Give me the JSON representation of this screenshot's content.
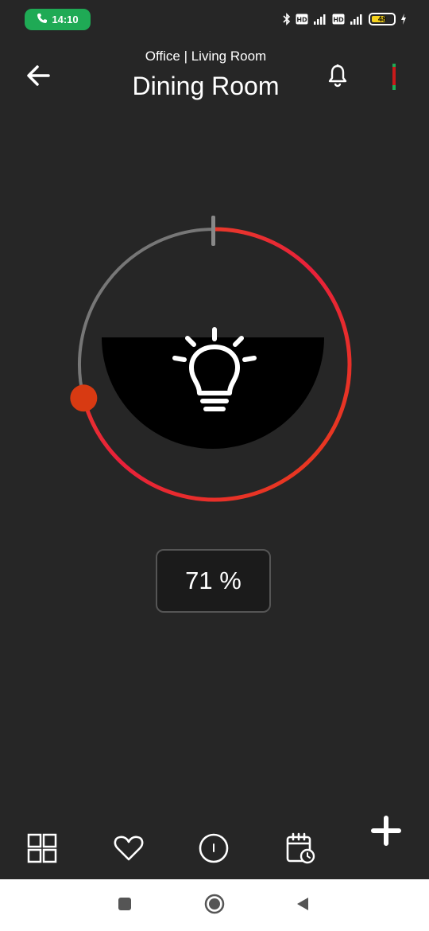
{
  "status_bar": {
    "call_time": "14:10",
    "call_icon": "phone-icon",
    "battery_level": "48",
    "icons": [
      "bluetooth-icon",
      "hd-icon",
      "signal-icon",
      "hd-icon",
      "signal-icon",
      "battery-icon",
      "charging-icon"
    ]
  },
  "header": {
    "breadcrumb": "Office | Living Room",
    "title": "Dining Room",
    "back_icon": "arrow-left-icon",
    "bell_icon": "bell-icon",
    "status_icon": "status-indicator-icon"
  },
  "dial": {
    "center_icon": "lightbulb-icon",
    "level_percent": 71,
    "active_color": "#e8401c",
    "inactive_color": "#777777",
    "knob_color": "#d83a12"
  },
  "value_display": {
    "text": "71 %"
  },
  "toolbar": {
    "items": [
      {
        "name": "grid-icon"
      },
      {
        "name": "heart-icon"
      },
      {
        "name": "power-icon"
      },
      {
        "name": "schedule-icon"
      }
    ],
    "add_icon": "plus-icon"
  },
  "nav": {
    "recent_icon": "square-icon",
    "home_icon": "circle-icon",
    "back_icon": "triangle-back-icon"
  },
  "colors": {
    "background": "#262626",
    "accent": "#e8401c",
    "call_pill": "#1faa55"
  }
}
